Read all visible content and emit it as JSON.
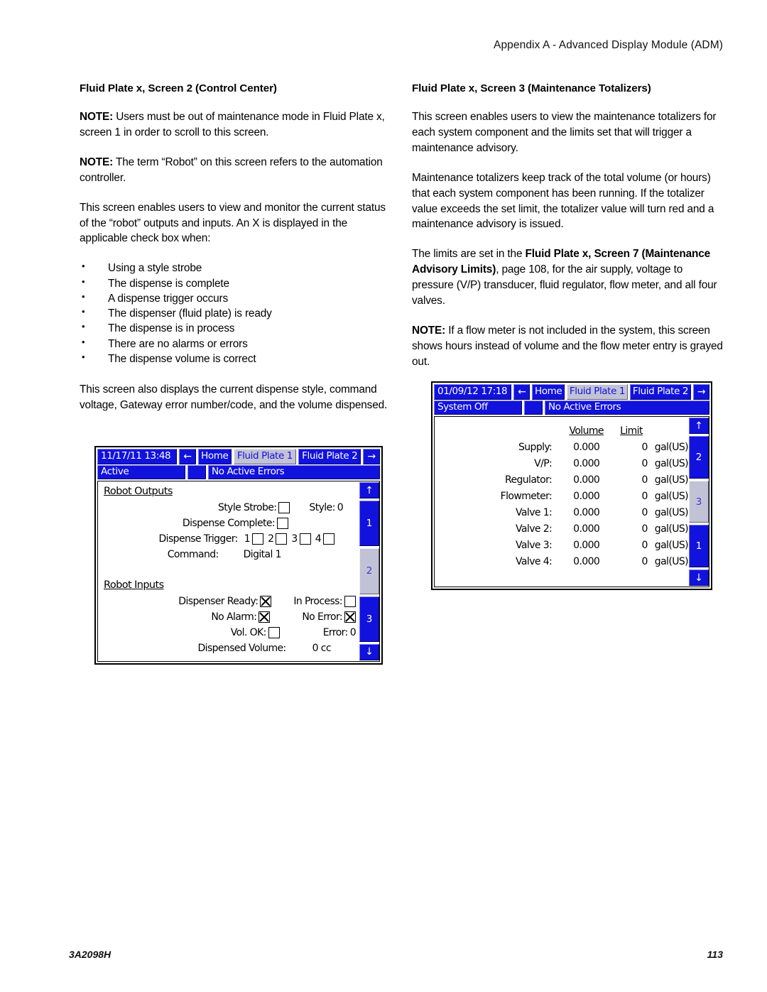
{
  "page": {
    "header": "Appendix A - Advanced Display Module (ADM)",
    "footer_code": "3A2098H",
    "footer_page": "113"
  },
  "left_column": {
    "title": "Fluid Plate x, Screen 2 (Control Center)",
    "note1_label": "NOTE:",
    "note1_text": " Users must be out of maintenance mode in Fluid Plate x, screen 1 in order to scroll to this screen.",
    "note2_label": "NOTE:",
    "note2_text": " The term “Robot” on this screen refers to the automation controller.",
    "para1": "This screen enables users to view and monitor the current status of the “robot” outputs and inputs. An X is displayed in the applicable check box when:",
    "bullets": [
      "Using a style strobe",
      "The dispense is complete",
      "A dispense trigger occurs",
      "The dispenser (fluid plate) is ready",
      "The dispense is in process",
      "There are no alarms or errors",
      "The dispense volume is correct"
    ],
    "para2": "This screen also displays the current dispense style, command voltage, Gateway error number/code, and the volume dispensed."
  },
  "right_column": {
    "title": "Fluid Plate x, Screen 3 (Maintenance Totalizers)",
    "para1": "This screen enables users to view the maintenance totalizers for each system component and the limits set that will trigger a maintenance advisory.",
    "para2": "Maintenance totalizers keep track of the total volume (or hours) that each system component has been running. If the totalizer value exceeds the set limit, the totalizer value will turn red and a maintenance advisory is issued.",
    "para3_a": "The limits are set in the ",
    "para3_bold": "Fluid Plate x, Screen 7 (Maintenance Advisory Limits)",
    "para3_b": ", page 108, for the air supply, voltage to pressure (V/P) transducer, fluid regulator, flow meter, and all four valves.",
    "note_label": "NOTE:",
    "note_text": " If a flow meter is not included in the system, this screen shows hours instead of volume and the flow meter entry is grayed out."
  },
  "adm_left": {
    "topbar": {
      "datetime": "11/17/11 13:48",
      "back_arrow": "←",
      "home": "Home",
      "plate1": "Fluid Plate 1",
      "plate2": "Fluid Plate 2",
      "forward_arrow": "→"
    },
    "statusbar": {
      "status": "Active",
      "errors": "No Active Errors"
    },
    "outputs": {
      "heading": "Robot Outputs",
      "style_strobe_label": "Style Strobe:",
      "style_strobe_checked": false,
      "style_label": "Style:",
      "style_value": "0",
      "dispense_complete_label": "Dispense Complete:",
      "dispense_complete_checked": false,
      "dispense_trigger_label": "Dispense Trigger:",
      "triggers": [
        {
          "num": "1",
          "checked": false
        },
        {
          "num": "2",
          "checked": false
        },
        {
          "num": "3",
          "checked": false
        },
        {
          "num": "4",
          "checked": false
        }
      ],
      "command_label": "Command:",
      "command_value": "Digital  1"
    },
    "inputs": {
      "heading": "Robot Inputs",
      "dispenser_ready_label": "Dispenser Ready:",
      "dispenser_ready_checked": true,
      "in_process_label": "In Process:",
      "in_process_checked": false,
      "no_alarm_label": "No Alarm:",
      "no_alarm_checked": true,
      "no_error_label": "No Error:",
      "no_error_checked": true,
      "vol_ok_label": "Vol. OK:",
      "vol_ok_checked": false,
      "error_label": "Error:",
      "error_value": "0",
      "dispensed_volume_label": "Dispensed Volume:",
      "dispensed_volume_value": "0 cc"
    },
    "sidebar": {
      "up": "↑",
      "down": "↓",
      "buttons": [
        {
          "label": "1",
          "active": false
        },
        {
          "label": "2",
          "active": true
        },
        {
          "label": "3",
          "active": false
        }
      ]
    }
  },
  "adm_right": {
    "topbar": {
      "datetime": "01/09/12 17:18",
      "back_arrow": "←",
      "home": "Home",
      "plate1": "Fluid Plate 1",
      "plate2": "Fluid Plate 2",
      "forward_arrow": "→"
    },
    "statusbar": {
      "status": "System Off",
      "errors": "No Active Errors"
    },
    "table": {
      "col_volume": "Volume",
      "col_limit": "Limit",
      "rows": [
        {
          "name": "Supply:",
          "volume": "0.000",
          "limit": "0",
          "unit": "gal(US)"
        },
        {
          "name": "V/P:",
          "volume": "0.000",
          "limit": "0",
          "unit": "gal(US)"
        },
        {
          "name": "Regulator:",
          "volume": "0.000",
          "limit": "0",
          "unit": "gal(US)"
        },
        {
          "name": "Flowmeter:",
          "volume": "0.000",
          "limit": "0",
          "unit": "gal(US)"
        },
        {
          "name": "Valve 1:",
          "volume": "0.000",
          "limit": "0",
          "unit": "gal(US)"
        },
        {
          "name": "Valve 2:",
          "volume": "0.000",
          "limit": "0",
          "unit": "gal(US)"
        },
        {
          "name": "Valve 3:",
          "volume": "0.000",
          "limit": "0",
          "unit": "gal(US)"
        },
        {
          "name": "Valve 4:",
          "volume": "0.000",
          "limit": "0",
          "unit": "gal(US)"
        }
      ]
    },
    "sidebar": {
      "up": "↑",
      "down": "↓",
      "buttons": [
        {
          "label": "2",
          "active": false
        },
        {
          "label": "3",
          "active": true
        },
        {
          "label": "1",
          "active": false
        }
      ]
    }
  },
  "colors": {
    "adm_blue": "#1212dd",
    "adm_active_gray": "#c2c2d6"
  }
}
